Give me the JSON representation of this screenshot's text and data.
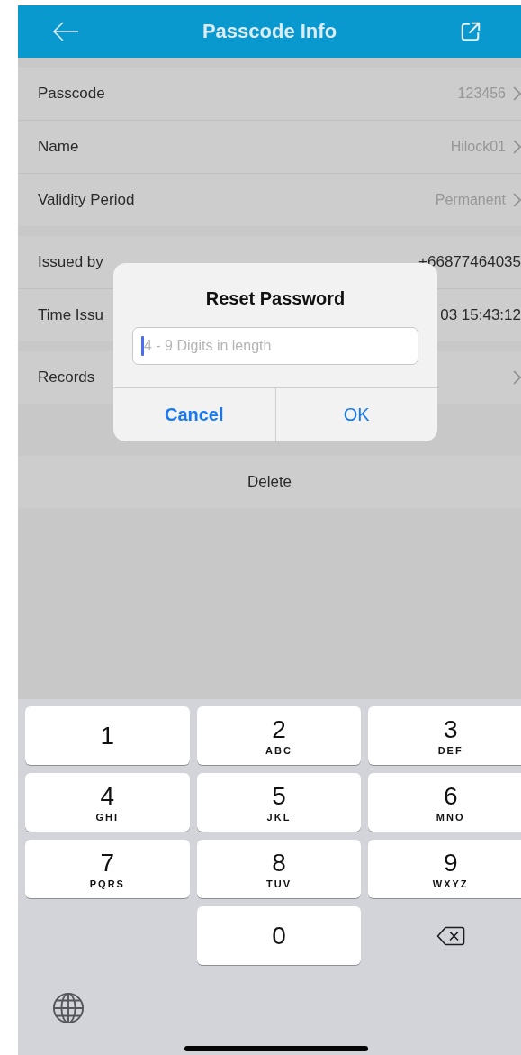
{
  "header": {
    "title": "Passcode Info"
  },
  "groups": [
    {
      "rows": [
        {
          "label": "Passcode",
          "value": "123456",
          "chevron": true
        },
        {
          "label": "Name",
          "value": "Hilock01",
          "chevron": true
        },
        {
          "label": "Validity Period",
          "value": "Permanent",
          "chevron": true
        }
      ]
    },
    {
      "rows": [
        {
          "label": "Issued by",
          "value": "+66877464035",
          "chevron": false
        },
        {
          "label": "Time Issu",
          "value": "03 15:43:12",
          "chevron": false
        }
      ]
    },
    {
      "rows": [
        {
          "label": "Records",
          "chevron": true
        }
      ]
    }
  ],
  "delete_button": "Delete",
  "dialog": {
    "title": "Reset Password",
    "placeholder": "4 - 9 Digits in length",
    "buttons": [
      {
        "label": "Cancel",
        "kind": "cancel"
      },
      {
        "label": "OK",
        "kind": "ok"
      }
    ]
  },
  "keyboard": {
    "keys": [
      {
        "kind": "digit",
        "digit": "1"
      },
      {
        "kind": "digit",
        "digit": "2",
        "letters": "ABC"
      },
      {
        "kind": "digit",
        "digit": "3",
        "letters": "DEF"
      },
      {
        "kind": "digit",
        "digit": "4",
        "letters": "GHI"
      },
      {
        "kind": "digit",
        "digit": "5",
        "letters": "JKL"
      },
      {
        "kind": "digit",
        "digit": "6",
        "letters": "MNO"
      },
      {
        "kind": "digit",
        "digit": "7",
        "letters": "PQRS"
      },
      {
        "kind": "digit",
        "digit": "8",
        "letters": "TUV"
      },
      {
        "kind": "digit",
        "digit": "9",
        "letters": "WXYZ"
      },
      {
        "kind": "blank"
      },
      {
        "kind": "digit",
        "digit": "0"
      },
      {
        "kind": "backspace"
      }
    ]
  }
}
